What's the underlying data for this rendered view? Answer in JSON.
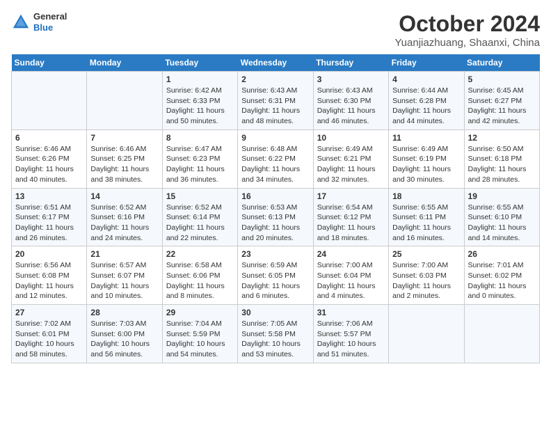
{
  "header": {
    "logo": {
      "general": "General",
      "blue": "Blue"
    },
    "title": "October 2024",
    "subtitle": "Yuanjiazhuang, Shaanxi, China"
  },
  "days_of_week": [
    "Sunday",
    "Monday",
    "Tuesday",
    "Wednesday",
    "Thursday",
    "Friday",
    "Saturday"
  ],
  "weeks": [
    [
      {
        "day": "",
        "content": ""
      },
      {
        "day": "",
        "content": ""
      },
      {
        "day": "1",
        "content": "Sunrise: 6:42 AM\nSunset: 6:33 PM\nDaylight: 11 hours and 50 minutes."
      },
      {
        "day": "2",
        "content": "Sunrise: 6:43 AM\nSunset: 6:31 PM\nDaylight: 11 hours and 48 minutes."
      },
      {
        "day": "3",
        "content": "Sunrise: 6:43 AM\nSunset: 6:30 PM\nDaylight: 11 hours and 46 minutes."
      },
      {
        "day": "4",
        "content": "Sunrise: 6:44 AM\nSunset: 6:28 PM\nDaylight: 11 hours and 44 minutes."
      },
      {
        "day": "5",
        "content": "Sunrise: 6:45 AM\nSunset: 6:27 PM\nDaylight: 11 hours and 42 minutes."
      }
    ],
    [
      {
        "day": "6",
        "content": "Sunrise: 6:46 AM\nSunset: 6:26 PM\nDaylight: 11 hours and 40 minutes."
      },
      {
        "day": "7",
        "content": "Sunrise: 6:46 AM\nSunset: 6:25 PM\nDaylight: 11 hours and 38 minutes."
      },
      {
        "day": "8",
        "content": "Sunrise: 6:47 AM\nSunset: 6:23 PM\nDaylight: 11 hours and 36 minutes."
      },
      {
        "day": "9",
        "content": "Sunrise: 6:48 AM\nSunset: 6:22 PM\nDaylight: 11 hours and 34 minutes."
      },
      {
        "day": "10",
        "content": "Sunrise: 6:49 AM\nSunset: 6:21 PM\nDaylight: 11 hours and 32 minutes."
      },
      {
        "day": "11",
        "content": "Sunrise: 6:49 AM\nSunset: 6:19 PM\nDaylight: 11 hours and 30 minutes."
      },
      {
        "day": "12",
        "content": "Sunrise: 6:50 AM\nSunset: 6:18 PM\nDaylight: 11 hours and 28 minutes."
      }
    ],
    [
      {
        "day": "13",
        "content": "Sunrise: 6:51 AM\nSunset: 6:17 PM\nDaylight: 11 hours and 26 minutes."
      },
      {
        "day": "14",
        "content": "Sunrise: 6:52 AM\nSunset: 6:16 PM\nDaylight: 11 hours and 24 minutes."
      },
      {
        "day": "15",
        "content": "Sunrise: 6:52 AM\nSunset: 6:14 PM\nDaylight: 11 hours and 22 minutes."
      },
      {
        "day": "16",
        "content": "Sunrise: 6:53 AM\nSunset: 6:13 PM\nDaylight: 11 hours and 20 minutes."
      },
      {
        "day": "17",
        "content": "Sunrise: 6:54 AM\nSunset: 6:12 PM\nDaylight: 11 hours and 18 minutes."
      },
      {
        "day": "18",
        "content": "Sunrise: 6:55 AM\nSunset: 6:11 PM\nDaylight: 11 hours and 16 minutes."
      },
      {
        "day": "19",
        "content": "Sunrise: 6:55 AM\nSunset: 6:10 PM\nDaylight: 11 hours and 14 minutes."
      }
    ],
    [
      {
        "day": "20",
        "content": "Sunrise: 6:56 AM\nSunset: 6:08 PM\nDaylight: 11 hours and 12 minutes."
      },
      {
        "day": "21",
        "content": "Sunrise: 6:57 AM\nSunset: 6:07 PM\nDaylight: 11 hours and 10 minutes."
      },
      {
        "day": "22",
        "content": "Sunrise: 6:58 AM\nSunset: 6:06 PM\nDaylight: 11 hours and 8 minutes."
      },
      {
        "day": "23",
        "content": "Sunrise: 6:59 AM\nSunset: 6:05 PM\nDaylight: 11 hours and 6 minutes."
      },
      {
        "day": "24",
        "content": "Sunrise: 7:00 AM\nSunset: 6:04 PM\nDaylight: 11 hours and 4 minutes."
      },
      {
        "day": "25",
        "content": "Sunrise: 7:00 AM\nSunset: 6:03 PM\nDaylight: 11 hours and 2 minutes."
      },
      {
        "day": "26",
        "content": "Sunrise: 7:01 AM\nSunset: 6:02 PM\nDaylight: 11 hours and 0 minutes."
      }
    ],
    [
      {
        "day": "27",
        "content": "Sunrise: 7:02 AM\nSunset: 6:01 PM\nDaylight: 10 hours and 58 minutes."
      },
      {
        "day": "28",
        "content": "Sunrise: 7:03 AM\nSunset: 6:00 PM\nDaylight: 10 hours and 56 minutes."
      },
      {
        "day": "29",
        "content": "Sunrise: 7:04 AM\nSunset: 5:59 PM\nDaylight: 10 hours and 54 minutes."
      },
      {
        "day": "30",
        "content": "Sunrise: 7:05 AM\nSunset: 5:58 PM\nDaylight: 10 hours and 53 minutes."
      },
      {
        "day": "31",
        "content": "Sunrise: 7:06 AM\nSunset: 5:57 PM\nDaylight: 10 hours and 51 minutes."
      },
      {
        "day": "",
        "content": ""
      },
      {
        "day": "",
        "content": ""
      }
    ]
  ]
}
